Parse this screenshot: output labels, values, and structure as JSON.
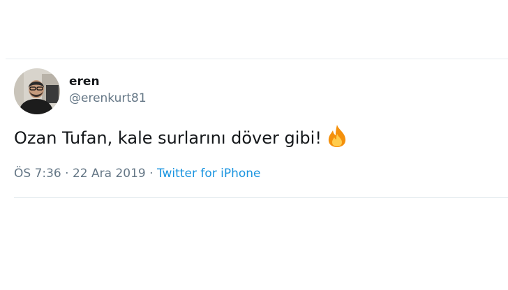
{
  "tweet": {
    "display_name": "eren",
    "handle": "@erenkurt81",
    "text": "Ozan Tufan, kale surlarını döver gibi!",
    "emoji_icon": "fire-icon",
    "time": "ÖS 7:36",
    "separator_1": " · ",
    "date": "22 Ara 2019",
    "separator_2": " · ",
    "source": "Twitter for iPhone"
  },
  "colors": {
    "name": "#14171a",
    "secondary": "#657786",
    "link": "#1b95e0",
    "divider": "#e6ecf0"
  }
}
